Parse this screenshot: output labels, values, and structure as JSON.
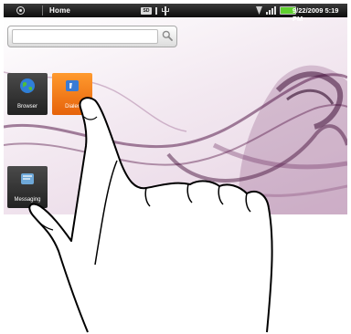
{
  "status_bar": {
    "title": "Home",
    "sd_label": "SD",
    "datetime": "9/22/2009 5:19 PM",
    "battery_color": "#5fd02f",
    "icons": [
      "menu-icon",
      "sd-card-icon",
      "alert-icon",
      "usb-icon",
      "wifi-icon",
      "signal-icon",
      "battery-icon"
    ]
  },
  "search_widget": {
    "value": "",
    "icon": "search-icon"
  },
  "apps": {
    "browser": {
      "label": "Browser",
      "icon": "globe-icon"
    },
    "dialer": {
      "label": "Dialer",
      "icon": "phone-icon"
    },
    "messaging": {
      "label": "Messaging",
      "icon": "message-icon"
    }
  },
  "wallpaper": {
    "accent": "#5a1f4e",
    "base": "#efe1ec"
  },
  "overlay": {
    "icon": "pointing-hand-icon"
  }
}
